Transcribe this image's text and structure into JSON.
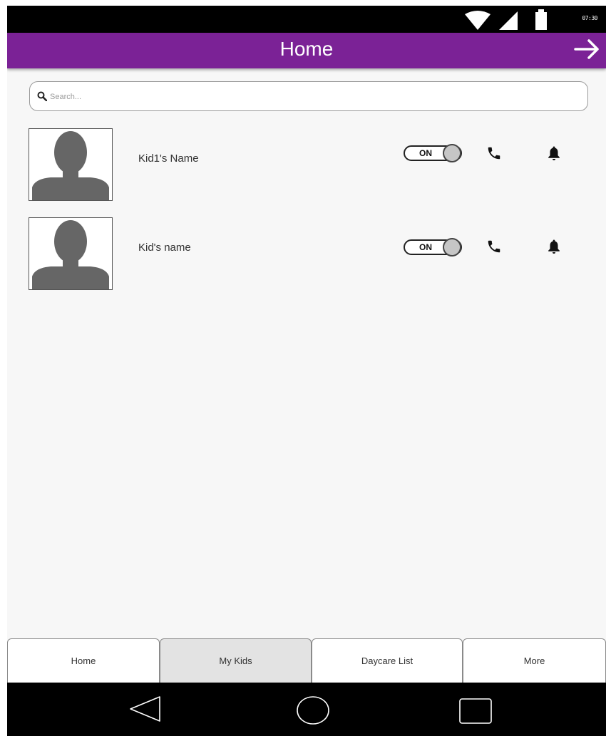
{
  "status_bar": {
    "time": "07:30"
  },
  "app_bar": {
    "title": "Home",
    "forward_icon": "arrow-right-icon"
  },
  "search": {
    "placeholder": "Search...",
    "value": "",
    "icon": "search-icon"
  },
  "kids": [
    {
      "name": "Kid1's Name",
      "toggle_label": "ON",
      "toggle_on": true
    },
    {
      "name": "Kid's name",
      "toggle_label": "ON",
      "toggle_on": true
    }
  ],
  "tabs": [
    {
      "label": "Home",
      "active": false
    },
    {
      "label": "My Kids",
      "active": true
    },
    {
      "label": "Daycare List",
      "active": false
    },
    {
      "label": "More",
      "active": false
    }
  ],
  "colors": {
    "app_bar": "#7b2296",
    "status_bar": "#000000",
    "nav_bar": "#000000",
    "active_tab": "#e3e3e3"
  }
}
